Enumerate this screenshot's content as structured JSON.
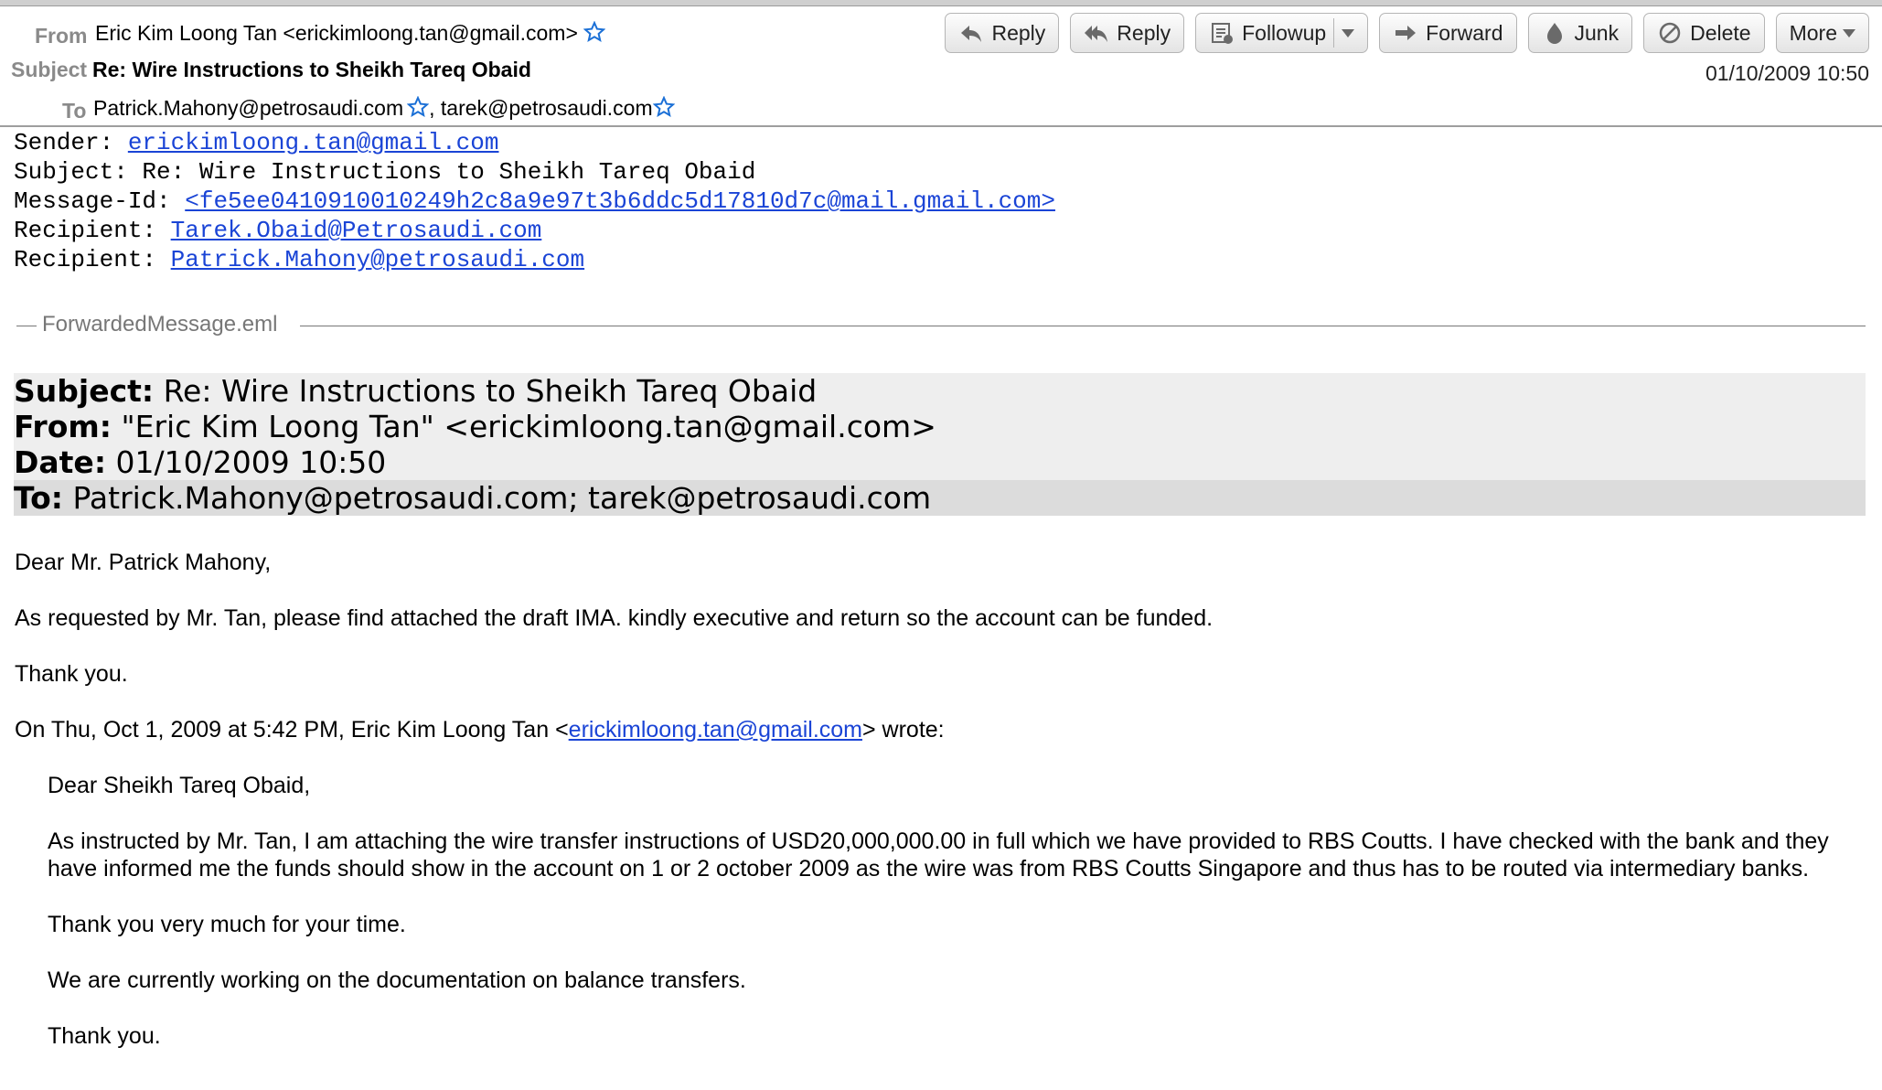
{
  "header": {
    "from_label": "From",
    "from_value": "Eric Kim Loong Tan <erickimloong.tan@gmail.com>",
    "subject_label": "Subject",
    "subject_value": "Re: Wire Instructions to Sheikh Tareq Obaid",
    "to_label": "To",
    "to_1": "Patrick.Mahony@petrosaudi.com",
    "to_sep": ",",
    "to_2": "tarek@petrosaudi.com",
    "date": "01/10/2009 10:50",
    "star_color": "#1a6fd6"
  },
  "toolbar": {
    "reply": "Reply",
    "reply_all": "Reply",
    "followup": "Followup",
    "forward": "Forward",
    "junk": "Junk",
    "delete": "Delete",
    "more": "More"
  },
  "raw": {
    "sender_label": "Sender: ",
    "sender_value": "erickimloong.tan@gmail.com",
    "subject_line": "Subject: Re: Wire Instructions to Sheikh Tareq Obaid",
    "msgid_label": "Message-Id: ",
    "msgid_value": "<fe5ee0410910010249h2c8a9e97t3b6ddc5d17810d7c@mail.gmail.com>",
    "recipient_label": "Recipient: ",
    "recipient_1": "Tarek.Obaid@Petrosaudi.com",
    "recipient_2": "Patrick.Mahony@petrosaudi.com"
  },
  "forwarded": {
    "attachment_name": "ForwardedMessage.eml",
    "subject_label": "Subject:",
    "subject_value": " Re: Wire Instructions to Sheikh Tareq Obaid",
    "from_label": "From:",
    "from_value": " \"Eric Kim Loong Tan\" <erickimloong.tan@gmail.com>",
    "date_label": "Date:",
    "date_value": " 01/10/2009 10:50",
    "to_label": "To:",
    "to_value": " Patrick.Mahony@petrosaudi.com; tarek@petrosaudi.com"
  },
  "body": {
    "greeting": "Dear Mr. Patrick Mahony,",
    "para1": "As requested by Mr. Tan, please find attached the draft IMA. kindly executive and return so the account can be funded.",
    "thanks1": "Thank you.",
    "quote_intro_pre": "On Thu, Oct 1, 2009 at 5:42 PM, Eric Kim Loong Tan <",
    "quote_intro_link": "erickimloong.tan@gmail.com",
    "quote_intro_post": "> wrote:",
    "q_greeting": "Dear Sheikh Tareq Obaid,",
    "q_para1": "As instructed by Mr. Tan, I am attaching the wire transfer instructions of USD20,000,000.00 in full which we have provided to RBS Coutts. I have checked with the bank and they have informed me the funds should show in the account on 1 or 2 october 2009 as the wire was from RBS Coutts Singapore and thus has to be routed via intermediary banks.",
    "q_para2": "Thank you very much for your time.",
    "q_para3": "We are currently working on the documentation on balance transfers.",
    "q_thanks": "Thank you."
  }
}
